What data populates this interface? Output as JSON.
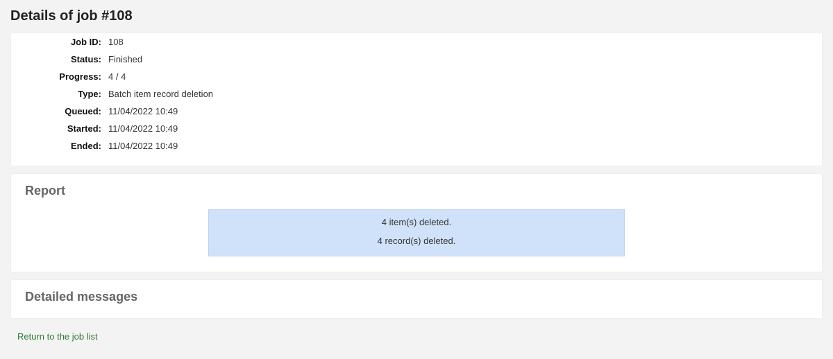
{
  "title": "Details of job #108",
  "details": {
    "labels": {
      "job_id": "Job ID:",
      "status": "Status:",
      "progress": "Progress:",
      "type": "Type:",
      "queued": "Queued:",
      "started": "Started:",
      "ended": "Ended:"
    },
    "values": {
      "job_id": "108",
      "status": "Finished",
      "progress": "4 / 4",
      "type": "Batch item record deletion",
      "queued": "11/04/2022 10:49",
      "started": "11/04/2022 10:49",
      "ended": "11/04/2022 10:49"
    }
  },
  "report": {
    "heading": "Report",
    "line1": "4 item(s) deleted.",
    "line2": "4 record(s) deleted."
  },
  "detailed": {
    "heading": "Detailed messages"
  },
  "return_link": "Return to the job list"
}
